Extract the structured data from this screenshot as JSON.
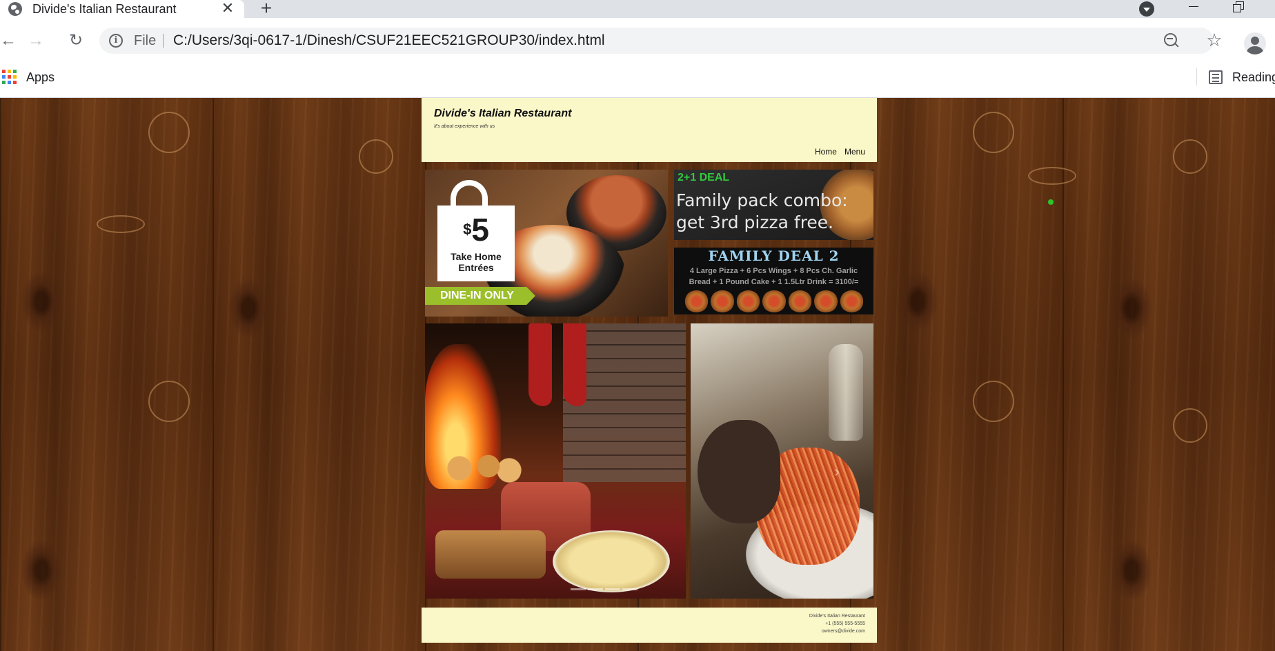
{
  "browser": {
    "tab_title": "Divide's Italian Restaurant",
    "tab_close_glyph": "✕",
    "new_tab_glyph": "+",
    "back_glyph": "←",
    "forward_glyph": "→",
    "reload_glyph": "↻",
    "info_glyph": "i",
    "scheme_label": "File",
    "url": "C:/Users/3qi-0617-1/Dinesh/CSUF21EEC521GROUP30/index.html",
    "star_glyph": "☆",
    "bookmarks": {
      "apps_label": "Apps",
      "reading_label": "Reading"
    }
  },
  "site": {
    "title": "Divide's Italian Restaurant",
    "tagline": "It's about experience with us",
    "nav": [
      "Home",
      "Menu"
    ],
    "promo_take_home": {
      "price_symbol": "$",
      "price": "5",
      "line1": "Take Home",
      "line2": "Entrées",
      "ribbon": "DINE-IN ONLY"
    },
    "promo_deal1": {
      "tag": "2+1 DEAL",
      "line1": "Family pack combo:",
      "line2": "get 3rd pizza free."
    },
    "promo_deal2": {
      "title": "FAMILY DEAL 2",
      "line1": "4 Large Pizza + 6 Pcs Wings + 8 Pcs Ch. Garlic",
      "line2": "Bread + 1 Pound Cake + 1 1.5Ltr Drink = 3100/="
    },
    "carousel_next_glyph": "›",
    "footer": {
      "name": "Divide's Italian Restaurant",
      "phone": "+1 (555) 555-5555",
      "email": "owners@divide.com"
    }
  },
  "colors": {
    "header_bg": "#faf8c8",
    "deal_green": "#32c93c",
    "ribbon_green": "#9bbf2a",
    "wood": "#5a2f12"
  }
}
